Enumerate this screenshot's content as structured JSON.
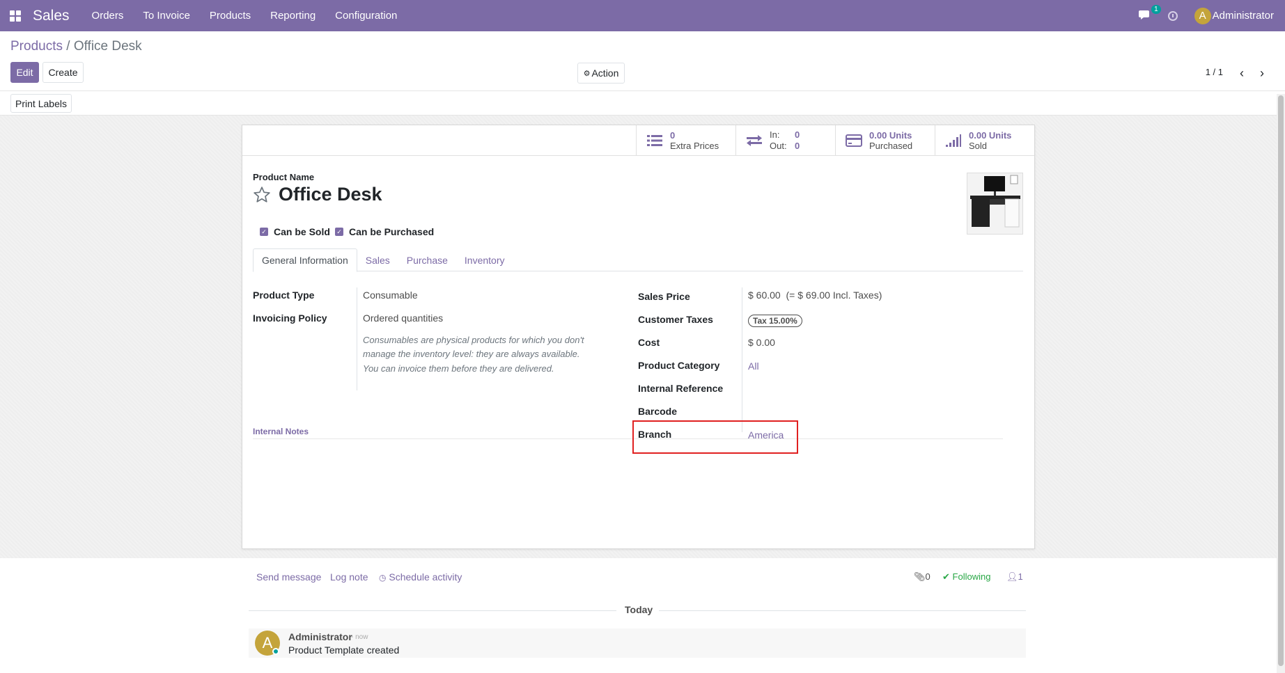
{
  "navbar": {
    "app_name": "Sales",
    "menu": [
      "Orders",
      "To Invoice",
      "Products",
      "Reporting",
      "Configuration"
    ],
    "chat_badge": "1",
    "avatar_letter": "A",
    "user_name": "Administrator",
    "color": "#7c6ba6"
  },
  "breadcrumb": {
    "parent": "Products",
    "separator": "/",
    "current": "Office Desk"
  },
  "toolbar": {
    "edit_label": "Edit",
    "create_label": "Create",
    "action_label": "Action",
    "print_labels_label": "Print Labels"
  },
  "pager": {
    "value": "1 / 1"
  },
  "stats": {
    "extra_prices_value": "0",
    "extra_prices_label": "Extra Prices",
    "in_label": "In:",
    "in_value": "0",
    "out_label": "Out:",
    "out_value": "0",
    "purchased_value": "0.00 Units",
    "purchased_label": "Purchased",
    "sold_value": "0.00 Units",
    "sold_label": "Sold"
  },
  "product": {
    "name_label": "Product Name",
    "name": "Office Desk",
    "can_be_sold_label": "Can be Sold",
    "can_be_purchased_label": "Can be Purchased"
  },
  "tabs": [
    "General Information",
    "Sales",
    "Purchase",
    "Inventory"
  ],
  "general": {
    "product_type_label": "Product Type",
    "product_type": "Consumable",
    "invoicing_policy_label": "Invoicing Policy",
    "invoicing_policy": "Ordered quantities",
    "help_line1": "Consumables are physical products for which you don't",
    "help_line2": "manage the inventory level: they are always available.",
    "help_line3": "You can invoice them before they are delivered.",
    "sales_price_label": "Sales Price",
    "sales_price": "$ 60.00",
    "sales_price_incl": "(= $ 69.00 Incl. Taxes)",
    "customer_taxes_label": "Customer Taxes",
    "tax_tag": "Tax 15.00%",
    "cost_label": "Cost",
    "cost": "$ 0.00",
    "category_label": "Product Category",
    "category": "All",
    "internal_ref_label": "Internal Reference",
    "barcode_label": "Barcode",
    "branch_label": "Branch",
    "branch": "America"
  },
  "notes": {
    "label": "Internal Notes"
  },
  "chatter": {
    "send_message": "Send message",
    "log_note": "Log note",
    "schedule_activity": "Schedule activity",
    "attachments_count": "0",
    "following_label": "Following",
    "followers_count": "1",
    "today_label": "Today",
    "message": {
      "avatar_letter": "A",
      "author": "Administrator",
      "date": "- now",
      "body": "Product Template created"
    }
  }
}
